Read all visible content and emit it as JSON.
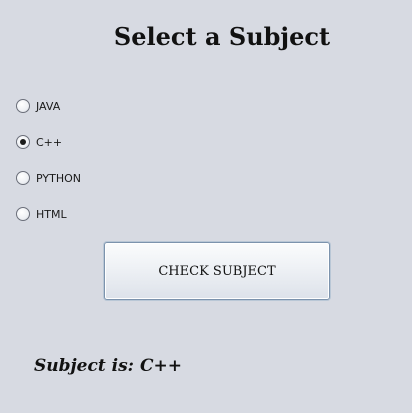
{
  "title": "Select a Subject",
  "radios": [
    {
      "label": "JAVA",
      "checked": false
    },
    {
      "label": "C++",
      "checked": true
    },
    {
      "label": "PYTHON",
      "checked": false
    },
    {
      "label": "HTML",
      "checked": false
    }
  ],
  "check_button": {
    "label": "CHECK SUBJECT"
  },
  "result": {
    "prefix": "Subject is",
    "separator": ":",
    "value": "C++"
  }
}
